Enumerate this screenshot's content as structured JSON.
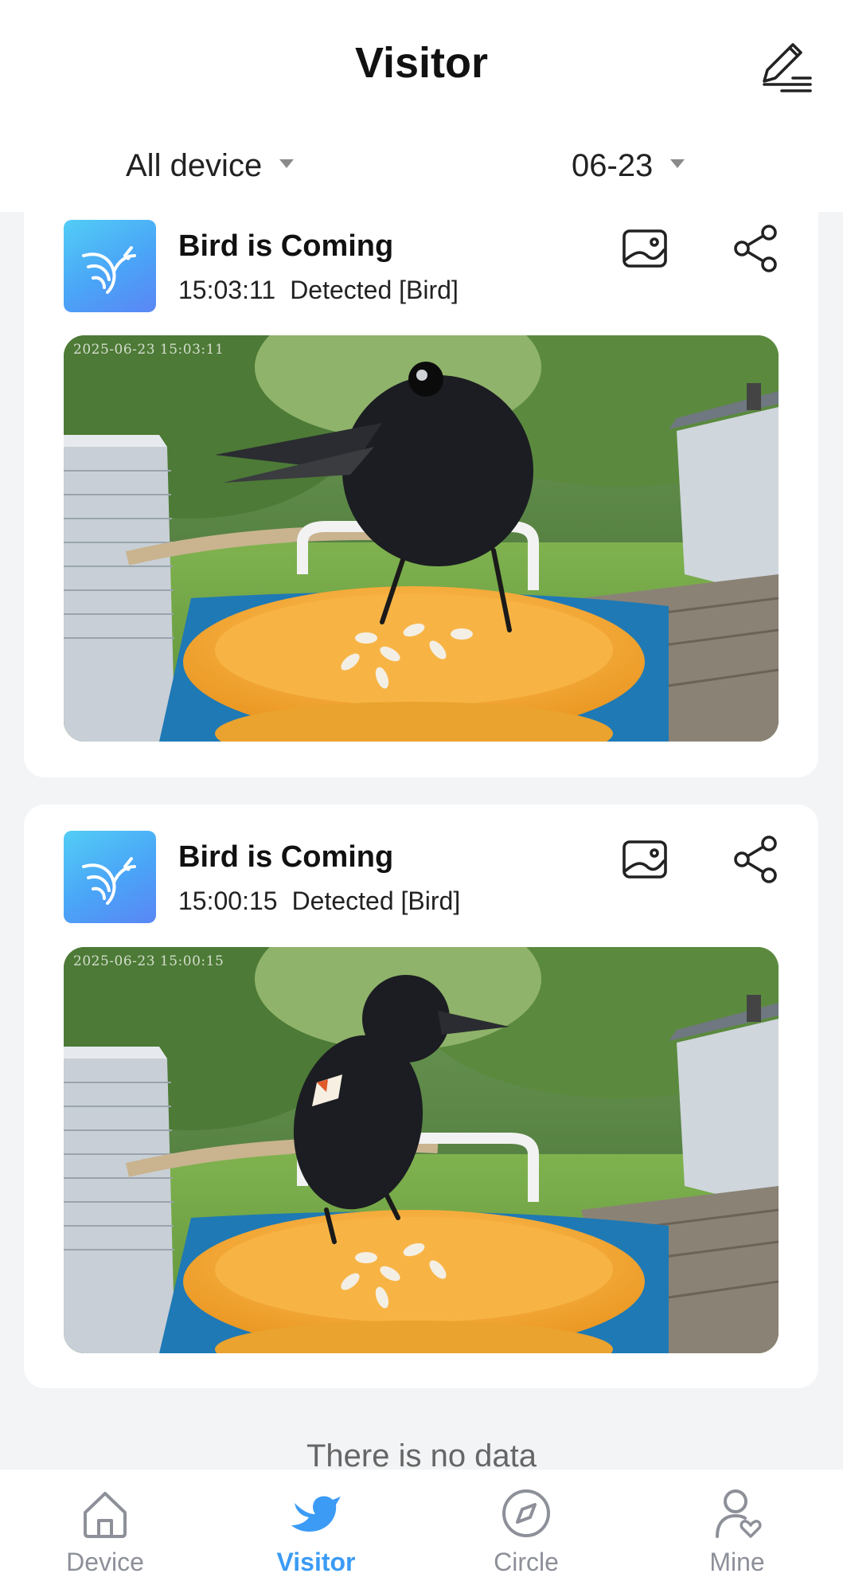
{
  "header": {
    "title": "Visitor",
    "filter_device": "All device",
    "filter_date": "06-23"
  },
  "events": [
    {
      "title": "Bird is Coming",
      "time": "15:03:11",
      "detected": "Detected [Bird]",
      "stamp": "2025-06-23 15:03:11"
    },
    {
      "title": "Bird is Coming",
      "time": "15:00:15",
      "detected": "Detected [Bird]",
      "stamp": "2025-06-23 15:00:15"
    }
  ],
  "empty_text": "There is no data",
  "nav": {
    "items": [
      {
        "label": "Device",
        "icon": "home-icon"
      },
      {
        "label": "Visitor",
        "icon": "bird-icon",
        "active": true
      },
      {
        "label": "Circle",
        "icon": "compass-icon"
      },
      {
        "label": "Mine",
        "icon": "user-heart-icon"
      }
    ]
  },
  "colors": {
    "accent": "#3b9bf5",
    "inactive": "#8d9099",
    "background": "#f3f4f6"
  }
}
